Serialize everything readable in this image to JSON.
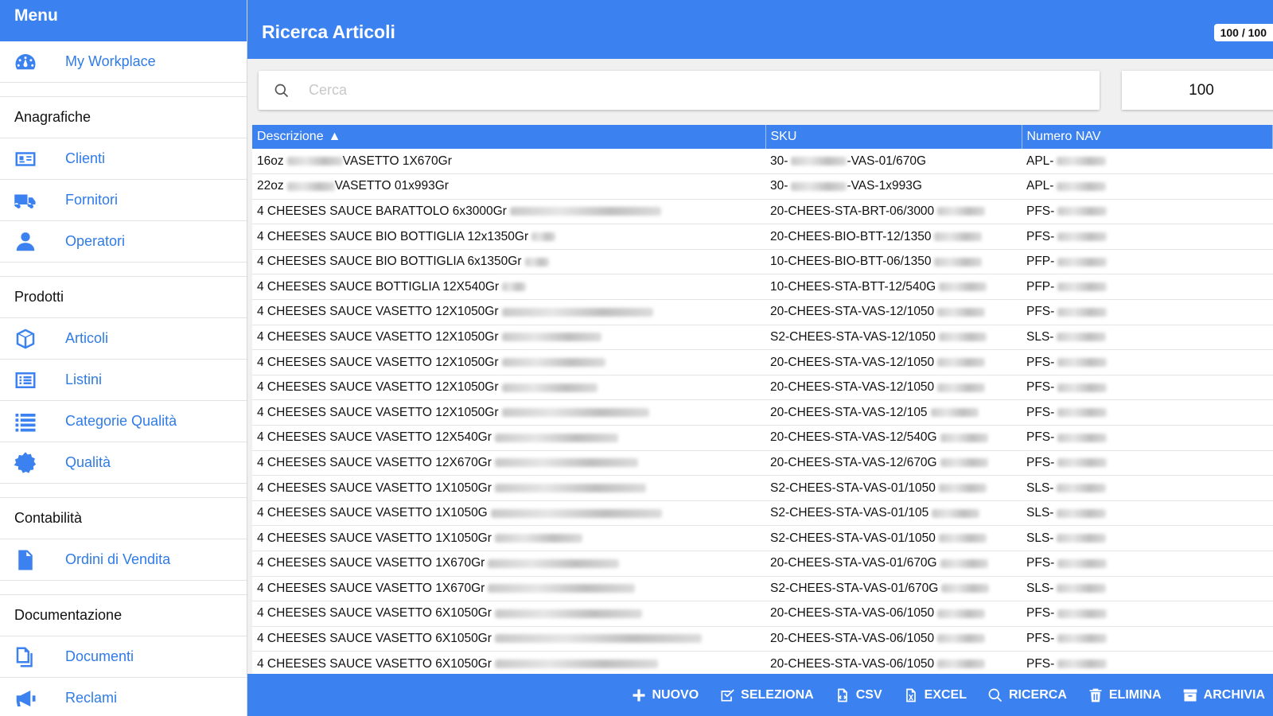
{
  "menu": {
    "title": "Menu",
    "top_item": {
      "label": "My Workplace",
      "icon": "dashboard-icon"
    },
    "sections": [
      {
        "title": "Anagrafiche",
        "items": [
          {
            "label": "Clienti",
            "icon": "id-card-icon"
          },
          {
            "label": "Fornitori",
            "icon": "truck-icon"
          },
          {
            "label": "Operatori",
            "icon": "user-icon"
          }
        ]
      },
      {
        "title": "Prodotti",
        "items": [
          {
            "label": "Articoli",
            "icon": "cube-icon"
          },
          {
            "label": "Listini",
            "icon": "list-alt-icon"
          },
          {
            "label": "Categorie Qualità",
            "icon": "list-icon"
          },
          {
            "label": "Qualità",
            "icon": "badge-icon"
          }
        ]
      },
      {
        "title": "Contabilità",
        "items": [
          {
            "label": "Ordini di Vendita",
            "icon": "file-text-icon"
          }
        ]
      },
      {
        "title": "Documentazione",
        "items": [
          {
            "label": "Documenti",
            "icon": "files-icon"
          },
          {
            "label": "Reclami",
            "icon": "megaphone-icon"
          }
        ]
      }
    ]
  },
  "header": {
    "title": "Ricerca Articoli",
    "counter": "100 / 100"
  },
  "search": {
    "placeholder": "Cerca",
    "value": "",
    "limit": "100"
  },
  "table": {
    "columns": [
      "Descrizione",
      "SKU",
      "Numero NAV"
    ],
    "rows": [
      {
        "desc": "16oz",
        "desc2": "VASETTO 1X670Gr",
        "sku": "30-",
        "sku2": "-VAS-01/670G",
        "nav": "APL-"
      },
      {
        "desc": "22oz",
        "desc2": "VASETTO 01x993Gr",
        "sku": "30-",
        "sku2": "-VAS-1x993G",
        "nav": "APL-"
      },
      {
        "desc": "4 CHEESES SAUCE BARATTOLO 6x3000Gr",
        "desc2": "",
        "sku": "20-CHEES-STA-BRT-06/3000",
        "sku2": "",
        "nav": "PFS-"
      },
      {
        "desc": "4 CHEESES SAUCE BIO BOTTIGLIA 12x1350Gr",
        "desc2": "",
        "sku": "20-CHEES-BIO-BTT-12/1350",
        "sku2": "",
        "nav": "PFS-"
      },
      {
        "desc": "4 CHEESES SAUCE BIO BOTTIGLIA 6x1350Gr",
        "desc2": "",
        "sku": "10-CHEES-BIO-BTT-06/1350",
        "sku2": "",
        "nav": "PFP-"
      },
      {
        "desc": "4 CHEESES SAUCE BOTTIGLIA 12X540Gr",
        "desc2": "",
        "sku": "10-CHEES-STA-BTT-12/540G",
        "sku2": "",
        "nav": "PFP-"
      },
      {
        "desc": "4 CHEESES SAUCE VASETTO 12X1050Gr",
        "desc2": "",
        "sku": "20-CHEES-STA-VAS-12/1050",
        "sku2": "",
        "nav": "PFS-"
      },
      {
        "desc": "4 CHEESES SAUCE VASETTO 12X1050Gr",
        "desc2": "",
        "sku": "S2-CHEES-STA-VAS-12/1050",
        "sku2": "",
        "nav": "SLS-"
      },
      {
        "desc": "4 CHEESES SAUCE VASETTO 12X1050Gr",
        "desc2": "",
        "sku": "20-CHEES-STA-VAS-12/1050",
        "sku2": "",
        "nav": "PFS-"
      },
      {
        "desc": "4 CHEESES SAUCE VASETTO 12X1050Gr",
        "desc2": "",
        "sku": "20-CHEES-STA-VAS-12/1050",
        "sku2": "",
        "nav": "PFS-"
      },
      {
        "desc": "4 CHEESES SAUCE VASETTO 12X1050Gr",
        "desc2": "",
        "sku": "20-CHEES-STA-VAS-12/105",
        "sku2": "",
        "nav": "PFS-"
      },
      {
        "desc": "4 CHEESES SAUCE VASETTO 12X540Gr",
        "desc2": "",
        "sku": "20-CHEES-STA-VAS-12/540G",
        "sku2": "",
        "nav": "PFS-"
      },
      {
        "desc": "4 CHEESES SAUCE VASETTO 12X670Gr",
        "desc2": "",
        "sku": "20-CHEES-STA-VAS-12/670G",
        "sku2": "",
        "nav": "PFS-"
      },
      {
        "desc": "4 CHEESES SAUCE VASETTO 1X1050Gr",
        "desc2": "",
        "sku": "S2-CHEES-STA-VAS-01/1050",
        "sku2": "",
        "nav": "SLS-"
      },
      {
        "desc": "4 CHEESES SAUCE VASETTO 1X1050G",
        "desc2": "",
        "sku": "S2-CHEES-STA-VAS-01/105",
        "sku2": "",
        "nav": "SLS-"
      },
      {
        "desc": "4 CHEESES SAUCE VASETTO 1X1050Gr",
        "desc2": "",
        "sku": "S2-CHEES-STA-VAS-01/1050",
        "sku2": "",
        "nav": "SLS-"
      },
      {
        "desc": "4 CHEESES SAUCE VASETTO 1X670Gr",
        "desc2": "",
        "sku": "20-CHEES-STA-VAS-01/670G",
        "sku2": "",
        "nav": "PFS-"
      },
      {
        "desc": "4 CHEESES SAUCE VASETTO 1X670Gr",
        "desc2": "",
        "sku": "S2-CHEES-STA-VAS-01/670G",
        "sku2": "",
        "nav": "SLS-"
      },
      {
        "desc": "4 CHEESES SAUCE VASETTO 6X1050Gr",
        "desc2": "",
        "sku": "20-CHEES-STA-VAS-06/1050",
        "sku2": "",
        "nav": "PFS-"
      },
      {
        "desc": "4 CHEESES SAUCE VASETTO 6X1050Gr",
        "desc2": "",
        "sku": "20-CHEES-STA-VAS-06/1050",
        "sku2": "",
        "nav": "PFS-"
      },
      {
        "desc": "4 CHEESES SAUCE VASETTO 6X1050Gr",
        "desc2": "",
        "sku": "20-CHEES-STA-VAS-06/1050",
        "sku2": "",
        "nav": "PFS-"
      }
    ]
  },
  "actions": [
    {
      "label": "NUOVO",
      "icon": "plus-icon"
    },
    {
      "label": "SELEZIONA",
      "icon": "check-square-icon"
    },
    {
      "label": "CSV",
      "icon": "csv-file-icon"
    },
    {
      "label": "EXCEL",
      "icon": "excel-file-icon"
    },
    {
      "label": "RICERCA",
      "icon": "search-icon"
    },
    {
      "label": "ELIMINA",
      "icon": "trash-icon"
    },
    {
      "label": "ARCHIVIA",
      "icon": "archive-icon"
    }
  ],
  "colors": {
    "primary": "#3b82f0",
    "link": "#2f7be8"
  }
}
